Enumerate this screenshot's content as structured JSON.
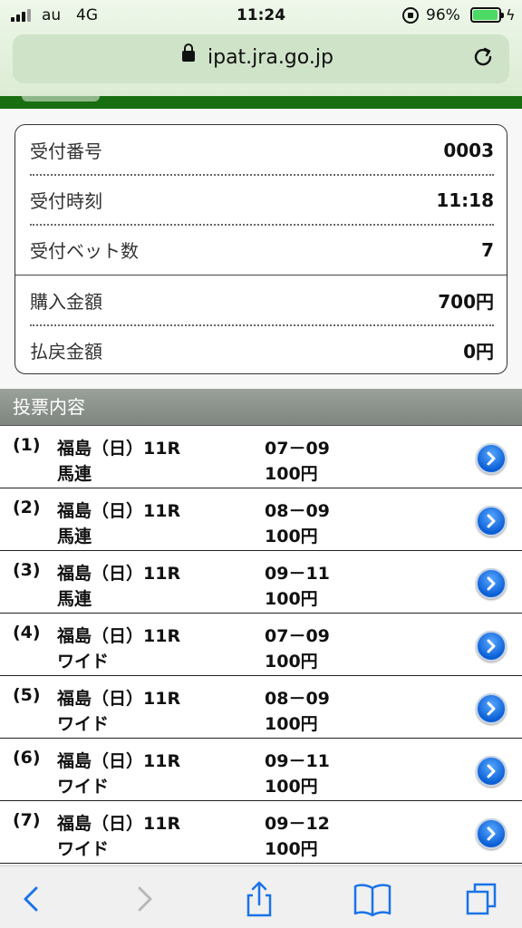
{
  "status_bar": {
    "carrier": "au",
    "network": "4G",
    "time": "11:24",
    "battery_percent": "96%"
  },
  "browser": {
    "url": "ipat.jra.go.jp"
  },
  "receipt": {
    "rows": [
      {
        "label": "受付番号",
        "value": "0003"
      },
      {
        "label": "受付時刻",
        "value": "11:18"
      },
      {
        "label": "受付ベット数",
        "value": "7"
      },
      {
        "label": "購入金額",
        "value": "700円"
      },
      {
        "label": "払戻金額",
        "value": "0円"
      }
    ]
  },
  "bets": {
    "section_title": "投票内容",
    "items": [
      {
        "no": "(1)",
        "race": "福島（日）11R",
        "type": "馬連",
        "combo": "07－09",
        "amount": "100円"
      },
      {
        "no": "(2)",
        "race": "福島（日）11R",
        "type": "馬連",
        "combo": "08－09",
        "amount": "100円"
      },
      {
        "no": "(3)",
        "race": "福島（日）11R",
        "type": "馬連",
        "combo": "09－11",
        "amount": "100円"
      },
      {
        "no": "(4)",
        "race": "福島（日）11R",
        "type": "ワイド",
        "combo": "07－09",
        "amount": "100円"
      },
      {
        "no": "(5)",
        "race": "福島（日）11R",
        "type": "ワイド",
        "combo": "08－09",
        "amount": "100円"
      },
      {
        "no": "(6)",
        "race": "福島（日）11R",
        "type": "ワイド",
        "combo": "09－11",
        "amount": "100円"
      },
      {
        "no": "(7)",
        "race": "福島（日）11R",
        "type": "ワイド",
        "combo": "09－12",
        "amount": "100円"
      }
    ]
  },
  "toolbar": {
    "icons": [
      "back-icon",
      "forward-icon",
      "share-icon",
      "bookmarks-icon",
      "tabs-icon"
    ]
  },
  "colors": {
    "site_green": "#1a6e12",
    "section_header": "#8a908a",
    "chevron_blue": "#0a5fd6"
  }
}
